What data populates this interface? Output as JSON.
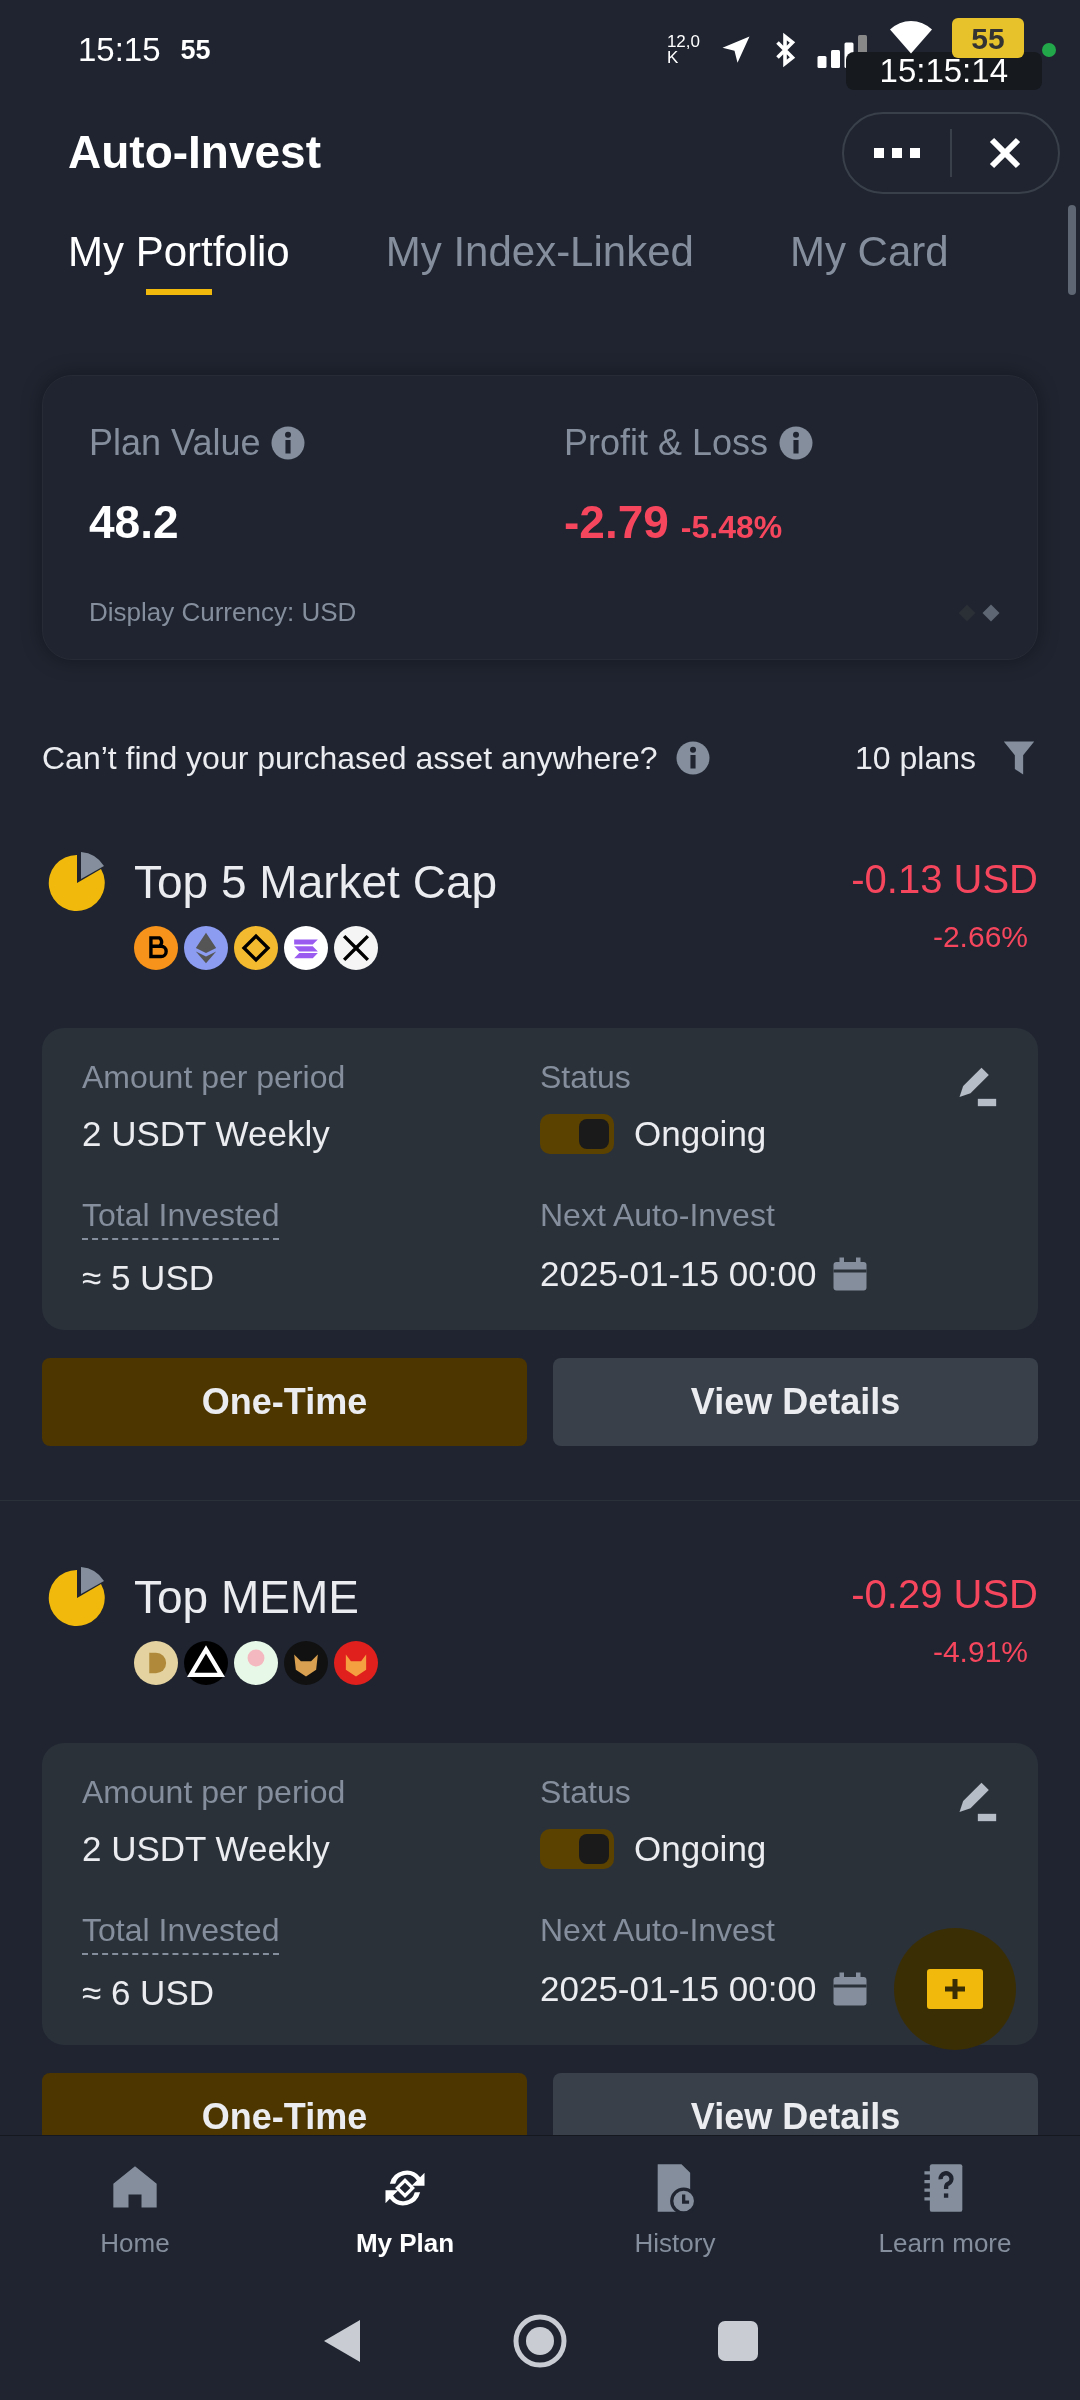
{
  "status_bar": {
    "time": "15:15",
    "extra": "55",
    "net_speed_value": "12,0",
    "net_speed_unit": "K",
    "battery": "55",
    "overlay_clock": "15:15:14"
  },
  "header": {
    "title": "Auto-Invest"
  },
  "tabs": [
    {
      "label": "My Portfolio",
      "selected": true
    },
    {
      "label": "My Index-Linked",
      "selected": false
    },
    {
      "label": "My Card",
      "selected": false
    }
  ],
  "summary": {
    "plan_value_label": "Plan Value",
    "plan_value": "48.2",
    "pnl_label": "Profit & Loss",
    "pnl_value": "-2.79",
    "pnl_percent": "-5.48%",
    "currency_note": "Display Currency: USD",
    "pager": [
      {
        "selected": false
      },
      {
        "selected": true
      }
    ]
  },
  "notice": {
    "text": "Can’t find your purchased asset anywhere?",
    "plan_count": "10 plans"
  },
  "plans": [
    {
      "name": "Top 5 Market Cap",
      "pnl": "-0.13 USD",
      "pnl_percent": "-2.66%",
      "coins": [
        {
          "color": "#f7931a"
        },
        {
          "color": "#8c9cf0"
        },
        {
          "color": "#f3ba2f"
        },
        {
          "color": "#ffffff"
        },
        {
          "color": "#f5f5f5"
        }
      ],
      "amount_label": "Amount per period",
      "amount": "2 USDT Weekly",
      "status_label": "Status",
      "status": "Ongoing",
      "on": true,
      "total_label": "Total Invested",
      "total": "≈ 5 USD",
      "next_label": "Next Auto-Invest",
      "next": "2025-01-15 00:00",
      "buttons": [
        "One-Time",
        "View Details"
      ]
    },
    {
      "name": "Top MEME",
      "pnl": "-0.29 USD",
      "pnl_percent": "-4.91%",
      "coins": [
        {
          "color": "#e4d3a0"
        },
        {
          "color": "#000000"
        },
        {
          "color": "#e8f8e8"
        },
        {
          "color": "#111111"
        },
        {
          "color": "#e0201c"
        }
      ],
      "amount_label": "Amount per period",
      "amount": "2 USDT Weekly",
      "status_label": "Status",
      "status": "Ongoing",
      "on": true,
      "total_label": "Total Invested",
      "total": "≈ 6 USD",
      "next_label": "Next Auto-Invest",
      "next": "2025-01-15 00:00",
      "buttons": [
        "One-Time",
        "View Details"
      ]
    }
  ],
  "nav": [
    {
      "label": "Home",
      "selected": false
    },
    {
      "label": "My Plan",
      "selected": true
    },
    {
      "label": "History",
      "selected": false
    },
    {
      "label": "Learn more",
      "selected": false
    }
  ]
}
